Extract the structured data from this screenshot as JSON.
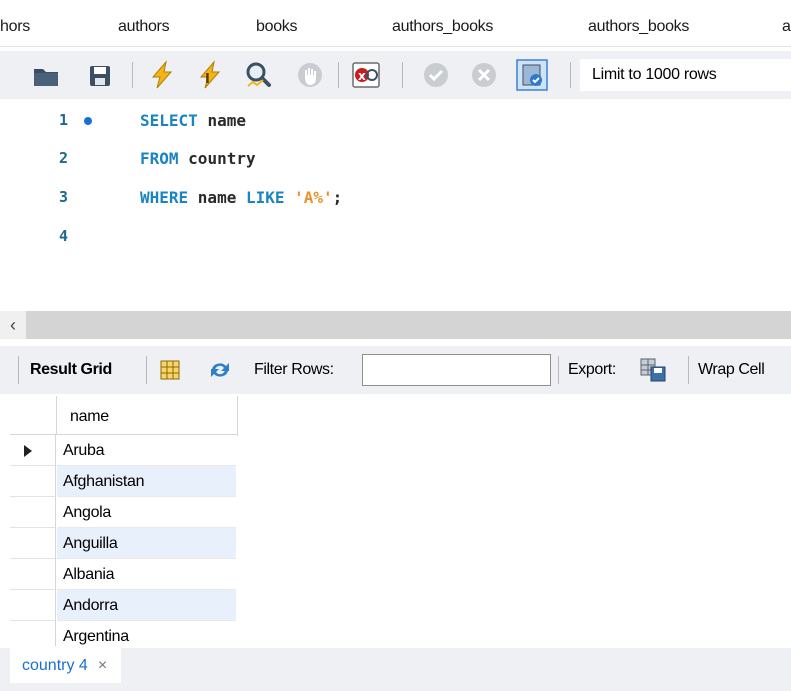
{
  "tabs": [
    {
      "label": "hors"
    },
    {
      "label": "authors"
    },
    {
      "label": "books"
    },
    {
      "label": "authors_books"
    },
    {
      "label": "authors_books"
    },
    {
      "label": "a"
    }
  ],
  "toolbar": {
    "limit_label": "Limit to 1000 rows",
    "icons": [
      "open-folder-icon",
      "save-icon",
      "execute-icon",
      "execute-current-icon",
      "explain-icon",
      "stop-icon",
      "toggle-error-icon",
      "commit-icon",
      "rollback-icon",
      "autocommit-icon"
    ]
  },
  "editor": {
    "lines": [
      {
        "num": "1",
        "tokens": [
          [
            "kw",
            "SELECT "
          ],
          [
            "id",
            "name"
          ]
        ]
      },
      {
        "num": "2",
        "tokens": [
          [
            "kw",
            "FROM "
          ],
          [
            "id",
            "country"
          ]
        ]
      },
      {
        "num": "3",
        "tokens": [
          [
            "kw",
            "WHERE "
          ],
          [
            "id",
            "name "
          ],
          [
            "kw",
            "LIKE "
          ],
          [
            "str",
            "'A%'"
          ],
          [
            "id",
            ";"
          ]
        ]
      },
      {
        "num": "4",
        "tokens": []
      }
    ]
  },
  "result_toolbar": {
    "result_grid": "Result Grid",
    "filter_rows": "Filter Rows:",
    "filter_value": "",
    "export": "Export:",
    "wrap_cell": "Wrap Cell"
  },
  "grid": {
    "column": "name",
    "rows": [
      "Aruba",
      "Afghanistan",
      "Angola",
      "Anguilla",
      "Albania",
      "Andorra",
      "Argentina"
    ]
  },
  "bottom_tab": {
    "label": "country 4",
    "close": "×"
  },
  "colors": {
    "keyword": "#1a84c4",
    "string": "#e8932a",
    "line_number": "#1c6a8c",
    "toolbar_bg": "#eef0f3",
    "row_alt": "#e8f0fb"
  }
}
